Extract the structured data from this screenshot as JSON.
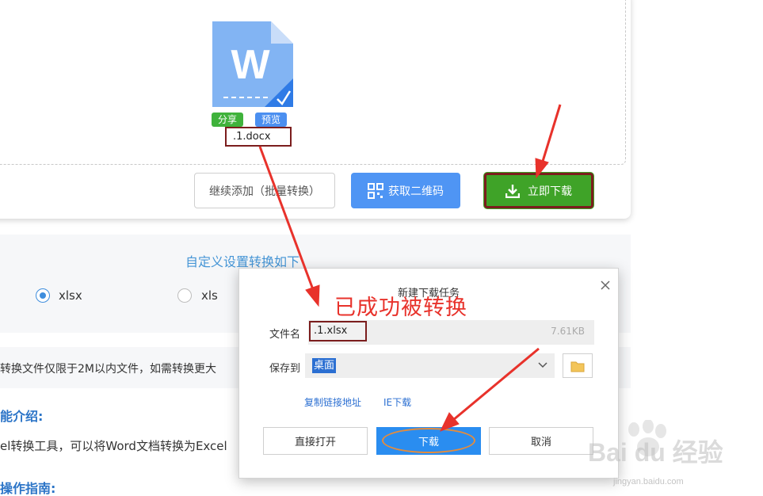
{
  "upload": {
    "file_name": ".1.docx",
    "share_tag": "分享",
    "preview_tag": "预览",
    "continue_label": "继续添加（批量转换）",
    "qr_label": "获取二维码",
    "download_label": "立即下载"
  },
  "settings": {
    "title": "自定义设置转换如下",
    "options": [
      "xlsx",
      "xls"
    ],
    "selected": "xlsx"
  },
  "page": {
    "notice": "转换文件仅限于2M以内文件，如需转换更大",
    "intro_heading": "能介绍:",
    "intro_text": "el转换工具，可以将Word文档转换为Excel",
    "guide_heading": "操作指南:"
  },
  "dialog": {
    "title": "新建下载任务",
    "file_name_label": "文件名",
    "file_name_value": ".1.xlsx",
    "file_size": "7.61KB",
    "save_to_label": "保存到",
    "save_to_value": "桌面",
    "copy_link": "复制链接地址",
    "ie_download": "IE下载",
    "open_button": "直接打开",
    "download_button": "下载",
    "cancel_button": "取消"
  },
  "annotation": {
    "text": "已成功被转换",
    "color": "#e8322b"
  },
  "watermark": {
    "brand": "Bai du 经验",
    "sub": "jingyan.baidu.com"
  },
  "colors": {
    "green": "#3fa328",
    "blue": "#4f95f4",
    "highlight_box": "#7b1d1d"
  }
}
